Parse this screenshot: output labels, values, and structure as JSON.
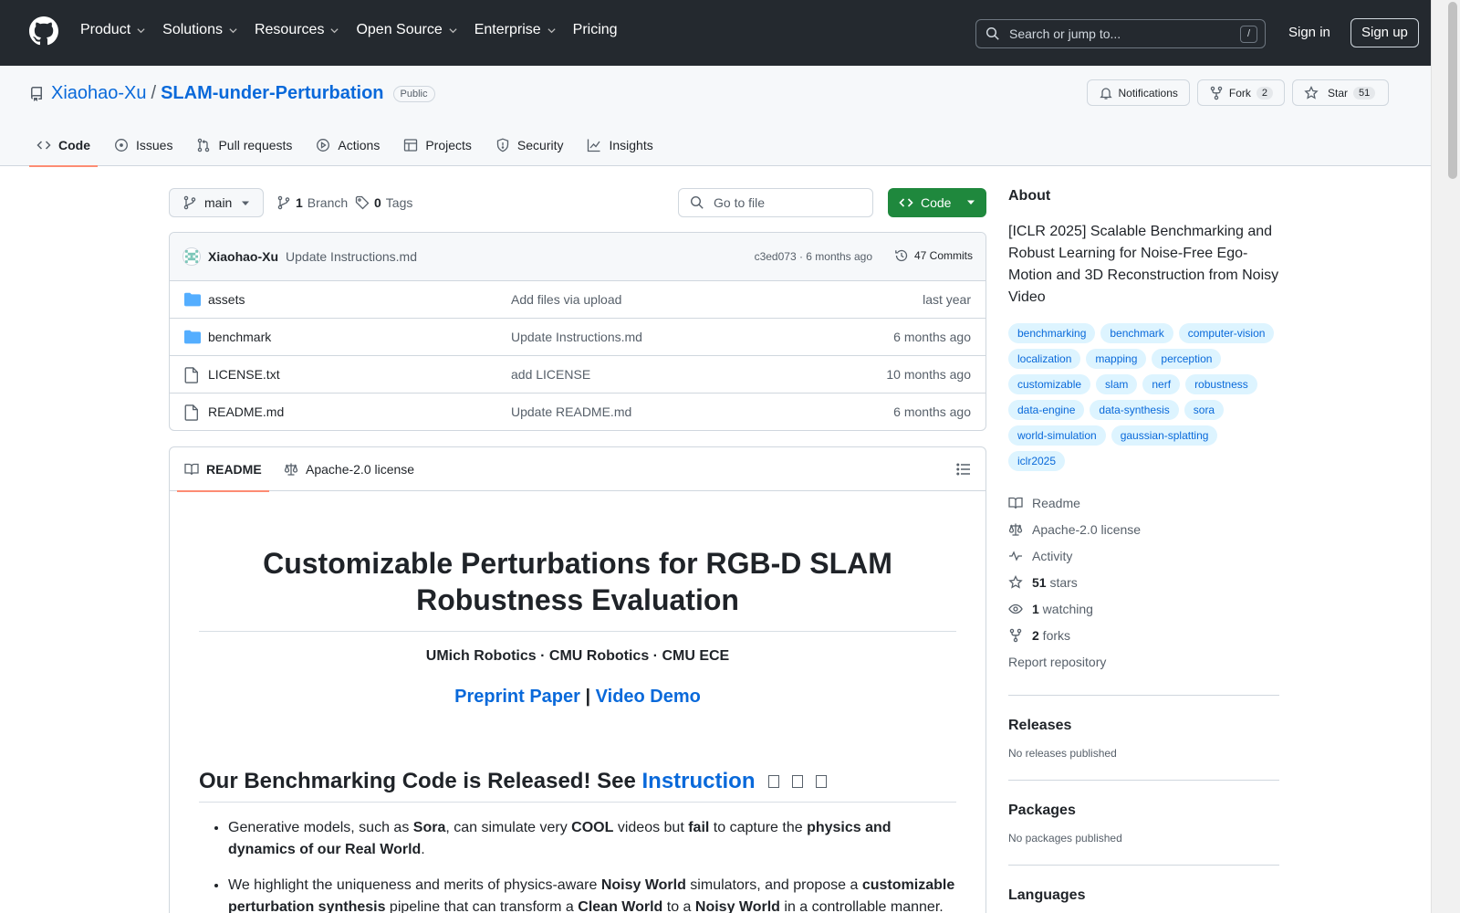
{
  "header": {
    "nav": [
      "Product",
      "Solutions",
      "Resources",
      "Open Source",
      "Enterprise",
      "Pricing"
    ],
    "search_placeholder": "Search or jump to...",
    "search_shortcut": "/",
    "signin": "Sign in",
    "signup": "Sign up"
  },
  "repo": {
    "owner": "Xiaohao-Xu",
    "separator": "/",
    "name": "SLAM-under-Perturbation",
    "visibility": "Public",
    "notifications_label": "Notifications",
    "fork_label": "Fork",
    "fork_count": "2",
    "star_label": "Star",
    "star_count": "51"
  },
  "tabs": [
    "Code",
    "Issues",
    "Pull requests",
    "Actions",
    "Projects",
    "Security",
    "Insights"
  ],
  "toolbar": {
    "branch": "main",
    "branch_count": "1",
    "branch_label": "Branch",
    "tag_count": "0",
    "tag_label": "Tags",
    "goto_placeholder": "Go to file",
    "code_label": "Code"
  },
  "latest_commit": {
    "author": "Xiaohao-Xu",
    "message": "Update Instructions.md",
    "meta": "c3ed073 · 6 months ago",
    "commits": "47 Commits"
  },
  "files": [
    {
      "type": "folder",
      "name": "assets",
      "message": "Add files via upload",
      "date": "last year"
    },
    {
      "type": "folder",
      "name": "benchmark",
      "message": "Update Instructions.md",
      "date": "6 months ago"
    },
    {
      "type": "file",
      "name": "LICENSE.txt",
      "message": "add LICENSE",
      "date": "10 months ago"
    },
    {
      "type": "file",
      "name": "README.md",
      "message": "Update README.md",
      "date": "6 months ago"
    }
  ],
  "readme": {
    "tab_readme": "README",
    "tab_license": "Apache-2.0 license",
    "title": "Customizable Perturbations for RGB-D SLAM Robustness Evaluation",
    "affiliations": "UMich Robotics · CMU Robotics · CMU ECE",
    "link_paper": "Preprint Paper",
    "link_sep": " | ",
    "link_video": "Video Demo",
    "h2_prefix": "Our Benchmarking Code is Released! See ",
    "h2_link": "Instruction",
    "bullet1": {
      "t1": "Generative models, such as ",
      "b1": "Sora",
      "t2": ", can simulate very ",
      "b2": "COOL",
      "t3": " videos but ",
      "b3": "fail",
      "t4": " to capture the ",
      "b4": "physics and dynamics of our Real World",
      "t5": "."
    },
    "bullet2": {
      "t1": "We highlight the uniqueness and merits of physics-aware ",
      "b1": "Noisy World",
      "t2": " simulators, and propose a ",
      "b2": "customizable perturbation synthesis",
      "t3": " pipeline that can transform a ",
      "b3": "Clean World",
      "t4": " to a ",
      "b4": "Noisy World",
      "t5": " in a controllable manner."
    }
  },
  "about": {
    "title": "About",
    "description": "[ICLR 2025] Scalable Benchmarking and Robust Learning for Noise-Free Ego-Motion and 3D Reconstruction from Noisy Video",
    "topics": [
      "benchmarking",
      "benchmark",
      "computer-vision",
      "localization",
      "mapping",
      "perception",
      "customizable",
      "slam",
      "nerf",
      "robustness",
      "data-engine",
      "data-synthesis",
      "sora",
      "world-simulation",
      "gaussian-splatting",
      "iclr2025"
    ],
    "readme": "Readme",
    "license": "Apache-2.0 license",
    "activity": "Activity",
    "stars_count": "51",
    "stars_label": " stars",
    "watching_count": "1",
    "watching_label": " watching",
    "forks_count": "2",
    "forks_label": " forks",
    "report": "Report repository"
  },
  "releases": {
    "title": "Releases",
    "note": "No releases published"
  },
  "packages": {
    "title": "Packages",
    "note": "No packages published"
  },
  "languages": {
    "title": "Languages"
  },
  "colors": {
    "header_bg": "#24292f",
    "link": "#0969da",
    "primary_button": "#1f883d",
    "tab_underline": "#fd8c73",
    "topic_bg": "#ddf4ff",
    "language_bar": [
      "#e34c26",
      "#89e051",
      "#3572A5",
      "#f1e05a"
    ]
  },
  "icons": [
    "github-logo-icon",
    "search-icon",
    "repo-icon",
    "bell-icon",
    "fork-icon",
    "star-icon",
    "code-icon",
    "issue-icon",
    "pull-request-icon",
    "play-icon",
    "table-icon",
    "shield-icon",
    "graph-icon",
    "branch-icon",
    "tag-icon",
    "history-icon",
    "folder-icon",
    "file-icon",
    "book-icon",
    "law-icon",
    "list-icon",
    "pulse-icon",
    "eye-icon"
  ]
}
